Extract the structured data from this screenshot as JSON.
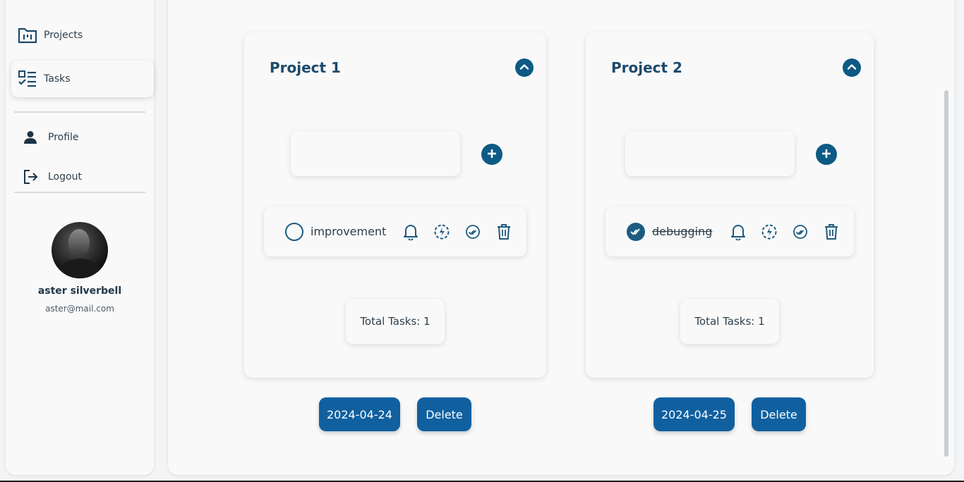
{
  "sidebar": {
    "nav": [
      {
        "label": "Projects",
        "icon": "projects-icon"
      },
      {
        "label": "Tasks",
        "icon": "tasks-icon",
        "active": true
      }
    ],
    "account": [
      {
        "label": "Profile",
        "icon": "person-icon"
      },
      {
        "label": "Logout",
        "icon": "logout-icon"
      }
    ],
    "user": {
      "name": "aster silverbell",
      "email": "aster@mail.com"
    }
  },
  "projects": [
    {
      "title": "Project 1",
      "new_task_value": "",
      "tasks": [
        {
          "text": "improvement",
          "completed": false
        }
      ],
      "total_label": "Total Tasks: 1",
      "date_label": "2024-04-24",
      "delete_label": "Delete"
    },
    {
      "title": "Project 2",
      "new_task_value": "",
      "tasks": [
        {
          "text": "debugging",
          "completed": true
        }
      ],
      "total_label": "Total Tasks: 1",
      "date_label": "2024-04-25",
      "delete_label": "Delete"
    }
  ],
  "colors": {
    "accent": "#0d5a85",
    "button": "#1060a0",
    "text": "#2e3f4c"
  }
}
